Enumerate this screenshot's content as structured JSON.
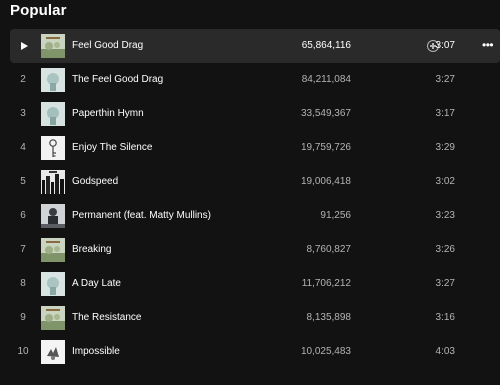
{
  "section": {
    "title": "Popular"
  },
  "tracks": [
    {
      "num": "1",
      "title": "Feel Good Drag",
      "plays": "65,864,116",
      "duration": "3:07",
      "cover": "cover-light-forest"
    },
    {
      "num": "2",
      "title": "The Feel Good Drag",
      "plays": "84,211,084",
      "duration": "3:27",
      "cover": "cover-light-figure"
    },
    {
      "num": "3",
      "title": "Paperthin Hymn",
      "plays": "33,549,367",
      "duration": "3:17",
      "cover": "cover-light-figure"
    },
    {
      "num": "4",
      "title": "Enjoy The Silence",
      "plays": "19,759,726",
      "duration": "3:29",
      "cover": "cover-key"
    },
    {
      "num": "5",
      "title": "Godspeed",
      "plays": "19,006,418",
      "duration": "3:02",
      "cover": "cover-city"
    },
    {
      "num": "6",
      "title": "Permanent (feat. Matty Mullins)",
      "plays": "91,256",
      "duration": "3:23",
      "cover": "cover-grey-figure"
    },
    {
      "num": "7",
      "title": "Breaking",
      "plays": "8,760,827",
      "duration": "3:26",
      "cover": "cover-light-forest"
    },
    {
      "num": "8",
      "title": "A Day Late",
      "plays": "11,706,212",
      "duration": "3:27",
      "cover": "cover-light-figure"
    },
    {
      "num": "9",
      "title": "The Resistance",
      "plays": "8,135,898",
      "duration": "3:16",
      "cover": "cover-light-forest"
    },
    {
      "num": "10",
      "title": "Impossible",
      "plays": "10,025,483",
      "duration": "4:03",
      "cover": "cover-white-splash"
    }
  ],
  "active_row": 0,
  "icons": {
    "play": "play-icon",
    "add": "add-to-playlist-icon",
    "more": "more-options-icon"
  },
  "colors": {
    "background": "#121212",
    "row_hover": "#2a2a2a",
    "text_primary": "#ffffff",
    "text_secondary": "#b3b3b3"
  }
}
